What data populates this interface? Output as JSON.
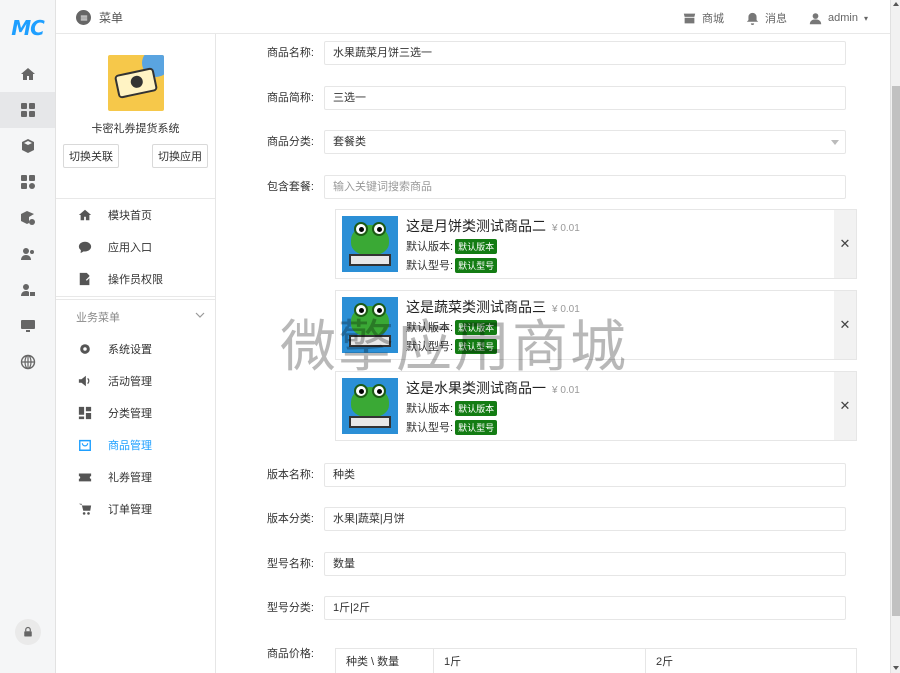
{
  "logo_text": "MC",
  "rail_icons": [
    "home-icon",
    "grid-icon",
    "cube-icon",
    "apps-icon",
    "box-settings-icon",
    "users-icon",
    "user-lock-icon",
    "monitor-icon",
    "globe-icon"
  ],
  "topbar": {
    "menu_label": "菜单",
    "shop_label": "商城",
    "messages_label": "消息",
    "user_label": "admin"
  },
  "sidebar": {
    "app_name": "卡密礼券提货系统",
    "switch_link_label": "切换关联",
    "switch_app_label": "切换应用",
    "top_items": [
      {
        "label": "模块首页",
        "icon": "home-icon"
      },
      {
        "label": "应用入口",
        "icon": "chat-icon"
      },
      {
        "label": "操作员权限",
        "icon": "edit-icon"
      }
    ],
    "group_title": "业务菜单",
    "group_items": [
      {
        "label": "系统设置",
        "icon": "gear-icon"
      },
      {
        "label": "活动管理",
        "icon": "speaker-icon"
      },
      {
        "label": "分类管理",
        "icon": "layout-icon"
      },
      {
        "label": "商品管理",
        "icon": "bag-icon"
      },
      {
        "label": "礼券管理",
        "icon": "ticket-icon"
      },
      {
        "label": "订单管理",
        "icon": "cart-icon"
      }
    ],
    "active_item": "商品管理"
  },
  "form": {
    "name": {
      "label": "商品名称:",
      "value": "水果蔬菜月饼三选一"
    },
    "short_name": {
      "label": "商品简称:",
      "value": "三选一"
    },
    "category": {
      "label": "商品分类:",
      "value": "套餐类"
    },
    "package": {
      "label": "包含套餐:",
      "placeholder": "输入关键词搜索商品"
    },
    "products": [
      {
        "title": "这是月饼类测试商品二",
        "price": "¥ 0.01",
        "version_label": "默认版本:",
        "version_tag": "默认版本",
        "model_label": "默认型号:",
        "model_tag": "默认型号"
      },
      {
        "title": "这是蔬菜类测试商品三",
        "price": "¥ 0.01",
        "version_label": "默认版本:",
        "version_tag": "默认版本",
        "model_label": "默认型号:",
        "model_tag": "默认型号"
      },
      {
        "title": "这是水果类测试商品一",
        "price": "¥ 0.01",
        "version_label": "默认版本:",
        "version_tag": "默认版本",
        "model_label": "默认型号:",
        "model_tag": "默认型号"
      }
    ],
    "version_name": {
      "label": "版本名称:",
      "value": "种类"
    },
    "version_class": {
      "label": "版本分类:",
      "value": "水果|蔬菜|月饼"
    },
    "model_name": {
      "label": "型号名称:",
      "value": "数量"
    },
    "model_class": {
      "label": "型号分类:",
      "value": "1斤|2斤"
    },
    "price": {
      "label": "商品价格:",
      "headers": [
        "种类 \\ 数量",
        "1斤",
        "2斤"
      ]
    }
  },
  "watermark": "微擎应用商城",
  "colors": {
    "accent": "#1e9fff",
    "tag_green": "#137c13"
  }
}
